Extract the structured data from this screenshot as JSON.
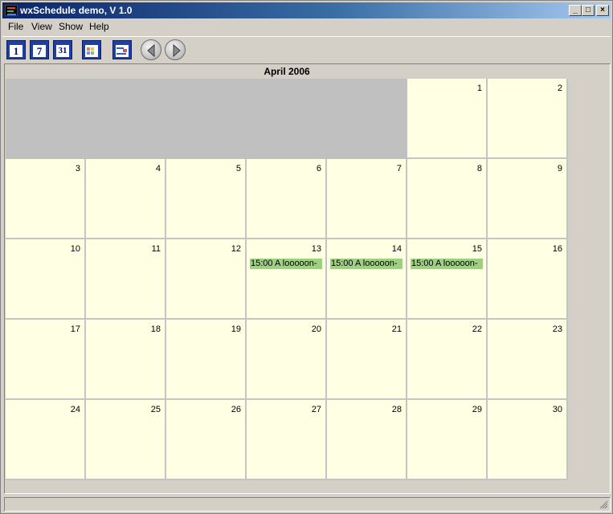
{
  "window": {
    "title": "wxSchedule demo, V 1.0",
    "controls": {
      "minimize": "_",
      "maximize": "□",
      "close": "×"
    }
  },
  "menu": [
    "File",
    "View",
    "Show",
    "Help"
  ],
  "toolbar": {
    "buttons": [
      {
        "name": "day-view",
        "icon": "calendar-day-icon",
        "text": "1"
      },
      {
        "name": "week-view",
        "icon": "calendar-week-icon",
        "text": "7"
      },
      {
        "name": "month-view",
        "icon": "calendar-month-icon",
        "text": "31"
      },
      {
        "name": "grid-view",
        "icon": "grid-view-icon"
      },
      {
        "name": "list-view",
        "icon": "list-view-icon"
      },
      {
        "name": "previous",
        "icon": "left-arrow-icon"
      },
      {
        "name": "next",
        "icon": "right-arrow-icon"
      }
    ]
  },
  "calendar": {
    "month_title": "April 2006",
    "days": [
      "1",
      "2",
      "3",
      "4",
      "5",
      "6",
      "7",
      "8",
      "9",
      "10",
      "11",
      "12",
      "13",
      "14",
      "15",
      "16",
      "17",
      "18",
      "19",
      "20",
      "21",
      "22",
      "23",
      "24",
      "25",
      "26",
      "27",
      "28",
      "29",
      "30"
    ],
    "events": [
      {
        "day": "13",
        "text": "15:00 A looooon-"
      },
      {
        "day": "14",
        "text": "15:00 A looooon-"
      },
      {
        "day": "15",
        "text": "15:00 A looooon-"
      }
    ],
    "colors": {
      "cell": "#ffffe4",
      "empty": "#c0c0c0",
      "event": "#9ecf82"
    }
  }
}
